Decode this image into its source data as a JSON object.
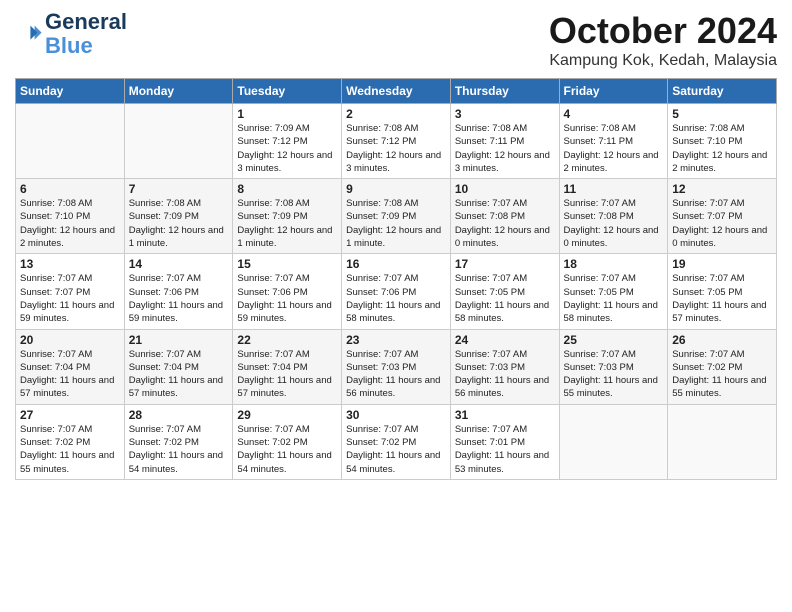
{
  "logo": {
    "line1": "General",
    "line2": "Blue"
  },
  "title": "October 2024",
  "location": "Kampung Kok, Kedah, Malaysia",
  "days_header": [
    "Sunday",
    "Monday",
    "Tuesday",
    "Wednesday",
    "Thursday",
    "Friday",
    "Saturday"
  ],
  "weeks": [
    [
      {
        "day": "",
        "info": ""
      },
      {
        "day": "",
        "info": ""
      },
      {
        "day": "1",
        "info": "Sunrise: 7:09 AM\nSunset: 7:12 PM\nDaylight: 12 hours and 3 minutes."
      },
      {
        "day": "2",
        "info": "Sunrise: 7:08 AM\nSunset: 7:12 PM\nDaylight: 12 hours and 3 minutes."
      },
      {
        "day": "3",
        "info": "Sunrise: 7:08 AM\nSunset: 7:11 PM\nDaylight: 12 hours and 3 minutes."
      },
      {
        "day": "4",
        "info": "Sunrise: 7:08 AM\nSunset: 7:11 PM\nDaylight: 12 hours and 2 minutes."
      },
      {
        "day": "5",
        "info": "Sunrise: 7:08 AM\nSunset: 7:10 PM\nDaylight: 12 hours and 2 minutes."
      }
    ],
    [
      {
        "day": "6",
        "info": "Sunrise: 7:08 AM\nSunset: 7:10 PM\nDaylight: 12 hours and 2 minutes."
      },
      {
        "day": "7",
        "info": "Sunrise: 7:08 AM\nSunset: 7:09 PM\nDaylight: 12 hours and 1 minute."
      },
      {
        "day": "8",
        "info": "Sunrise: 7:08 AM\nSunset: 7:09 PM\nDaylight: 12 hours and 1 minute."
      },
      {
        "day": "9",
        "info": "Sunrise: 7:08 AM\nSunset: 7:09 PM\nDaylight: 12 hours and 1 minute."
      },
      {
        "day": "10",
        "info": "Sunrise: 7:07 AM\nSunset: 7:08 PM\nDaylight: 12 hours and 0 minutes."
      },
      {
        "day": "11",
        "info": "Sunrise: 7:07 AM\nSunset: 7:08 PM\nDaylight: 12 hours and 0 minutes."
      },
      {
        "day": "12",
        "info": "Sunrise: 7:07 AM\nSunset: 7:07 PM\nDaylight: 12 hours and 0 minutes."
      }
    ],
    [
      {
        "day": "13",
        "info": "Sunrise: 7:07 AM\nSunset: 7:07 PM\nDaylight: 11 hours and 59 minutes."
      },
      {
        "day": "14",
        "info": "Sunrise: 7:07 AM\nSunset: 7:06 PM\nDaylight: 11 hours and 59 minutes."
      },
      {
        "day": "15",
        "info": "Sunrise: 7:07 AM\nSunset: 7:06 PM\nDaylight: 11 hours and 59 minutes."
      },
      {
        "day": "16",
        "info": "Sunrise: 7:07 AM\nSunset: 7:06 PM\nDaylight: 11 hours and 58 minutes."
      },
      {
        "day": "17",
        "info": "Sunrise: 7:07 AM\nSunset: 7:05 PM\nDaylight: 11 hours and 58 minutes."
      },
      {
        "day": "18",
        "info": "Sunrise: 7:07 AM\nSunset: 7:05 PM\nDaylight: 11 hours and 58 minutes."
      },
      {
        "day": "19",
        "info": "Sunrise: 7:07 AM\nSunset: 7:05 PM\nDaylight: 11 hours and 57 minutes."
      }
    ],
    [
      {
        "day": "20",
        "info": "Sunrise: 7:07 AM\nSunset: 7:04 PM\nDaylight: 11 hours and 57 minutes."
      },
      {
        "day": "21",
        "info": "Sunrise: 7:07 AM\nSunset: 7:04 PM\nDaylight: 11 hours and 57 minutes."
      },
      {
        "day": "22",
        "info": "Sunrise: 7:07 AM\nSunset: 7:04 PM\nDaylight: 11 hours and 57 minutes."
      },
      {
        "day": "23",
        "info": "Sunrise: 7:07 AM\nSunset: 7:03 PM\nDaylight: 11 hours and 56 minutes."
      },
      {
        "day": "24",
        "info": "Sunrise: 7:07 AM\nSunset: 7:03 PM\nDaylight: 11 hours and 56 minutes."
      },
      {
        "day": "25",
        "info": "Sunrise: 7:07 AM\nSunset: 7:03 PM\nDaylight: 11 hours and 55 minutes."
      },
      {
        "day": "26",
        "info": "Sunrise: 7:07 AM\nSunset: 7:02 PM\nDaylight: 11 hours and 55 minutes."
      }
    ],
    [
      {
        "day": "27",
        "info": "Sunrise: 7:07 AM\nSunset: 7:02 PM\nDaylight: 11 hours and 55 minutes."
      },
      {
        "day": "28",
        "info": "Sunrise: 7:07 AM\nSunset: 7:02 PM\nDaylight: 11 hours and 54 minutes."
      },
      {
        "day": "29",
        "info": "Sunrise: 7:07 AM\nSunset: 7:02 PM\nDaylight: 11 hours and 54 minutes."
      },
      {
        "day": "30",
        "info": "Sunrise: 7:07 AM\nSunset: 7:02 PM\nDaylight: 11 hours and 54 minutes."
      },
      {
        "day": "31",
        "info": "Sunrise: 7:07 AM\nSunset: 7:01 PM\nDaylight: 11 hours and 53 minutes."
      },
      {
        "day": "",
        "info": ""
      },
      {
        "day": "",
        "info": ""
      }
    ]
  ]
}
